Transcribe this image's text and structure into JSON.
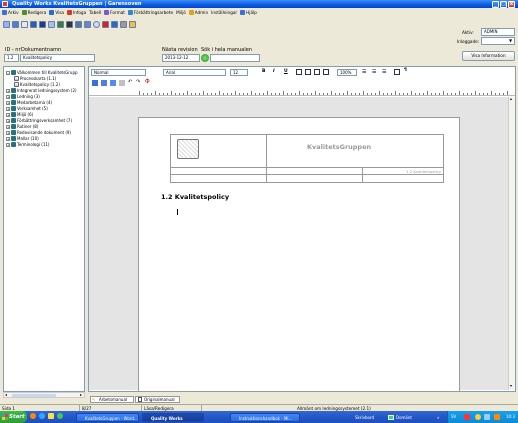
{
  "window": {
    "title": "Quality Works KvalitetsGruppen | Garensoven"
  },
  "menu": [
    {
      "label": "Arkiv",
      "icon": "file-icon",
      "color": "#3a6fd8"
    },
    {
      "label": "Redigera",
      "icon": "edit-icon",
      "color": "#5a8a2a"
    },
    {
      "label": "Visa",
      "icon": "view-icon",
      "color": "#2b6cc4"
    },
    {
      "label": "Infoga",
      "icon": "insert-icon",
      "color": "#d83a2a"
    },
    {
      "label": "Tabell",
      "icon": "",
      "color": ""
    },
    {
      "label": "Format",
      "icon": "format-icon",
      "color": "#7a5ac8"
    },
    {
      "label": "Förbättringsarbete",
      "icon": "improve-icon",
      "color": "#2a8ad8"
    },
    {
      "label": "Miljö",
      "icon": "",
      "color": ""
    },
    {
      "label": "Admin",
      "icon": "admin-icon",
      "color": "#e0a020"
    },
    {
      "label": "Inställningar",
      "icon": "",
      "color": ""
    },
    {
      "label": "Hjälp",
      "icon": "help-icon",
      "color": "#3a6fd8"
    }
  ],
  "user": {
    "aktiv_label": "Aktiv:",
    "aktiv_value": "ADMIN",
    "inloggade_label": "Inloggade:"
  },
  "doc_header": {
    "id_label": "ID - nr",
    "name_label": "Dokumentnamn",
    "id_value": "1.2",
    "name_value": "Kvalitetspolicy",
    "revision_label": "Nästa revision",
    "revision_value": "2013-12-12",
    "search_label": "Sök i hela manualen",
    "search_value": "",
    "info_button": "Visa Information"
  },
  "tree": [
    {
      "label": "Välkommen till KvalitetsGrupp",
      "level": 0,
      "icon": "globe-icon"
    },
    {
      "label": "Processkarta (1.1)",
      "level": 1,
      "icon": "doc-icon"
    },
    {
      "label": "Kvalitetspolicy (1.2)",
      "level": 1,
      "icon": "doc-icon"
    },
    {
      "label": "Integrerat ledningssystem (2)",
      "level": 0,
      "icon": "globe-icon"
    },
    {
      "label": "Ledning (3)",
      "level": 0,
      "icon": "globe-icon"
    },
    {
      "label": "Medarbetarna (4)",
      "level": 0,
      "icon": "globe-icon"
    },
    {
      "label": "Verksamhet (5)",
      "level": 0,
      "icon": "globe-icon"
    },
    {
      "label": "Miljö (6)",
      "level": 0,
      "icon": "globe-icon"
    },
    {
      "label": "Förbättringsverksamhet (7)",
      "level": 0,
      "icon": "globe-icon"
    },
    {
      "label": "Rutiner (8)",
      "level": 0,
      "icon": "globe-icon"
    },
    {
      "label": "Redovisande dokument (9)",
      "level": 0,
      "icon": "globe-icon"
    },
    {
      "label": "Mallar (10)",
      "level": 0,
      "icon": "globe-icon"
    },
    {
      "label": "Terminologi (11)",
      "level": 0,
      "icon": "globe-icon"
    }
  ],
  "format_toolbar": {
    "style": "Normal",
    "font": "Arial",
    "size": "12",
    "zoom": "100%",
    "bold": "B",
    "italic": "I",
    "underline": "U",
    "pilcrow": "¶"
  },
  "document": {
    "company": "KvalitetsGruppen",
    "header_ref": "1.2 Kvalitetspolicy",
    "heading": "1.2 Kvalitetspolicy"
  },
  "tabs": [
    "Arbetsmanual",
    "Originalmanual"
  ],
  "status": {
    "cell1": "Sida 1",
    "cell2": "8/27",
    "cell3": "Läsa/Redigera",
    "cell4": "Allmänt om ledningssystemet (2.1)"
  },
  "taskbar": {
    "start": "Start",
    "tasks": [
      "KvalitetsGruppen - Word...",
      "Quality Works",
      "Instruktionshandbok - Mi..."
    ],
    "tray_items": [
      "Skrivbord",
      "Domänt"
    ],
    "lang": "SV",
    "clock": "10:3"
  }
}
